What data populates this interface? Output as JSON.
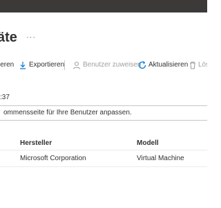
{
  "header": {
    "title": "äte",
    "more_label": "···"
  },
  "toolbar": {
    "items": [
      {
        "label": "ieren",
        "icon": ""
      },
      {
        "label": "Exportieren",
        "icon": "download-icon"
      },
      {
        "label": "Benutzer zuweisen",
        "icon": "person-icon",
        "disabled": true
      },
      {
        "label": "Aktualisieren",
        "icon": "refresh-icon"
      },
      {
        "label": "Lös",
        "icon": "delete-icon",
        "disabled": true
      }
    ]
  },
  "info": {
    "time_fragment": ":37",
    "banner_text": "ommensseite für Ihre Benutzer anpassen."
  },
  "table": {
    "columns": [
      "Hersteller",
      "Modell"
    ],
    "rows": [
      {
        "manufacturer": "Microsoft Corporation",
        "model": "Virtual Machine"
      }
    ]
  },
  "colors": {
    "topbar": "#3b3a39",
    "accent": "#0078d4",
    "disabled": "#a19f9d",
    "text": "#323130"
  }
}
